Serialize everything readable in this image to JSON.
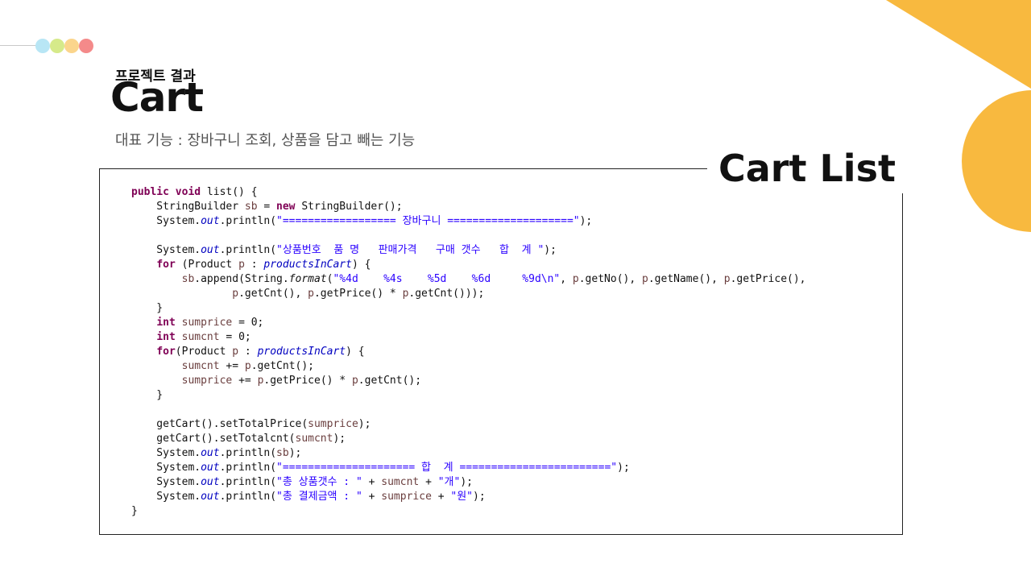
{
  "slide": {
    "subtitle": "프로젝트 결과",
    "title": "Cart",
    "description": "대표 기능 : 장바구니 조회, 상품을 담고 빼는 기능",
    "frame_label": "Cart List"
  },
  "colors": {
    "dot_colors": [
      "#b8e6f5",
      "#d6ea8a",
      "#fbd58c",
      "#f48a8a"
    ],
    "accent_orange": "#f8b93f",
    "keyword": "#7f0055",
    "string": "#2a00ff",
    "field": "#0000c0",
    "variable": "#6a3e3e"
  },
  "code": {
    "lines": [
      [
        [
          "kw",
          "public void"
        ],
        [
          "plain",
          " list() {"
        ]
      ],
      [
        [
          "plain",
          "    StringBuilder "
        ],
        [
          "var",
          "sb"
        ],
        [
          "plain",
          " = "
        ],
        [
          "kw",
          "new"
        ],
        [
          "plain",
          " StringBuilder();"
        ]
      ],
      [
        [
          "plain",
          "    System."
        ],
        [
          "field",
          "out"
        ],
        [
          "plain",
          ".println("
        ],
        [
          "str",
          "\"================== 장바구니 ====================\""
        ],
        [
          "plain",
          ");"
        ]
      ],
      [
        [
          "plain",
          ""
        ]
      ],
      [
        [
          "plain",
          "    System."
        ],
        [
          "field",
          "out"
        ],
        [
          "plain",
          ".println("
        ],
        [
          "str",
          "\"상품번호  품 명   판매가격   구매 갯수   합  계 \""
        ],
        [
          "plain",
          ");"
        ]
      ],
      [
        [
          "plain",
          "    "
        ],
        [
          "kw",
          "for"
        ],
        [
          "plain",
          " (Product "
        ],
        [
          "var",
          "p"
        ],
        [
          "plain",
          " : "
        ],
        [
          "field",
          "productsInCart"
        ],
        [
          "plain",
          ") {"
        ]
      ],
      [
        [
          "plain",
          "        "
        ],
        [
          "var",
          "sb"
        ],
        [
          "plain",
          ".append(String."
        ],
        [
          "fmt",
          "format"
        ],
        [
          "plain",
          "("
        ],
        [
          "str",
          "\"%4d    %4s    %5d    %6d     %9d\\n\""
        ],
        [
          "plain",
          ", "
        ],
        [
          "var",
          "p"
        ],
        [
          "plain",
          ".getNo(), "
        ],
        [
          "var",
          "p"
        ],
        [
          "plain",
          ".getName(), "
        ],
        [
          "var",
          "p"
        ],
        [
          "plain",
          ".getPrice(),"
        ]
      ],
      [
        [
          "plain",
          "                "
        ],
        [
          "var",
          "p"
        ],
        [
          "plain",
          ".getCnt(), "
        ],
        [
          "var",
          "p"
        ],
        [
          "plain",
          ".getPrice() * "
        ],
        [
          "var",
          "p"
        ],
        [
          "plain",
          ".getCnt()));"
        ]
      ],
      [
        [
          "plain",
          "    }"
        ]
      ],
      [
        [
          "plain",
          "    "
        ],
        [
          "kw",
          "int"
        ],
        [
          "plain",
          " "
        ],
        [
          "var",
          "sumprice"
        ],
        [
          "plain",
          " = 0;"
        ]
      ],
      [
        [
          "plain",
          "    "
        ],
        [
          "kw",
          "int"
        ],
        [
          "plain",
          " "
        ],
        [
          "var",
          "sumcnt"
        ],
        [
          "plain",
          " = 0;"
        ]
      ],
      [
        [
          "plain",
          "    "
        ],
        [
          "kw",
          "for"
        ],
        [
          "plain",
          "(Product "
        ],
        [
          "var",
          "p"
        ],
        [
          "plain",
          " : "
        ],
        [
          "field",
          "productsInCart"
        ],
        [
          "plain",
          ") {"
        ]
      ],
      [
        [
          "plain",
          "        "
        ],
        [
          "var",
          "sumcnt"
        ],
        [
          "plain",
          " += "
        ],
        [
          "var",
          "p"
        ],
        [
          "plain",
          ".getCnt();"
        ]
      ],
      [
        [
          "plain",
          "        "
        ],
        [
          "var",
          "sumprice"
        ],
        [
          "plain",
          " += "
        ],
        [
          "var",
          "p"
        ],
        [
          "plain",
          ".getPrice() * "
        ],
        [
          "var",
          "p"
        ],
        [
          "plain",
          ".getCnt();"
        ]
      ],
      [
        [
          "plain",
          "    }"
        ]
      ],
      [
        [
          "plain",
          ""
        ]
      ],
      [
        [
          "plain",
          "    getCart().setTotalPrice("
        ],
        [
          "var",
          "sumprice"
        ],
        [
          "plain",
          ");"
        ]
      ],
      [
        [
          "plain",
          "    getCart().setTotalcnt("
        ],
        [
          "var",
          "sumcnt"
        ],
        [
          "plain",
          ");"
        ]
      ],
      [
        [
          "plain",
          "    System."
        ],
        [
          "field",
          "out"
        ],
        [
          "plain",
          ".println("
        ],
        [
          "var",
          "sb"
        ],
        [
          "plain",
          ");"
        ]
      ],
      [
        [
          "plain",
          "    System."
        ],
        [
          "field",
          "out"
        ],
        [
          "plain",
          ".println("
        ],
        [
          "str",
          "\"===================== 합  계 ========================\""
        ],
        [
          "plain",
          ");"
        ]
      ],
      [
        [
          "plain",
          "    System."
        ],
        [
          "field",
          "out"
        ],
        [
          "plain",
          ".println("
        ],
        [
          "str",
          "\"총 상품갯수 : \""
        ],
        [
          "plain",
          " + "
        ],
        [
          "var",
          "sumcnt"
        ],
        [
          "plain",
          " + "
        ],
        [
          "str",
          "\"개\""
        ],
        [
          "plain",
          ");"
        ]
      ],
      [
        [
          "plain",
          "    System."
        ],
        [
          "field",
          "out"
        ],
        [
          "plain",
          ".println("
        ],
        [
          "str",
          "\"총 결제금액 : \""
        ],
        [
          "plain",
          " + "
        ],
        [
          "var",
          "sumprice"
        ],
        [
          "plain",
          " + "
        ],
        [
          "str",
          "\"원\""
        ],
        [
          "plain",
          ");"
        ]
      ],
      [
        [
          "plain",
          "}"
        ]
      ]
    ]
  }
}
